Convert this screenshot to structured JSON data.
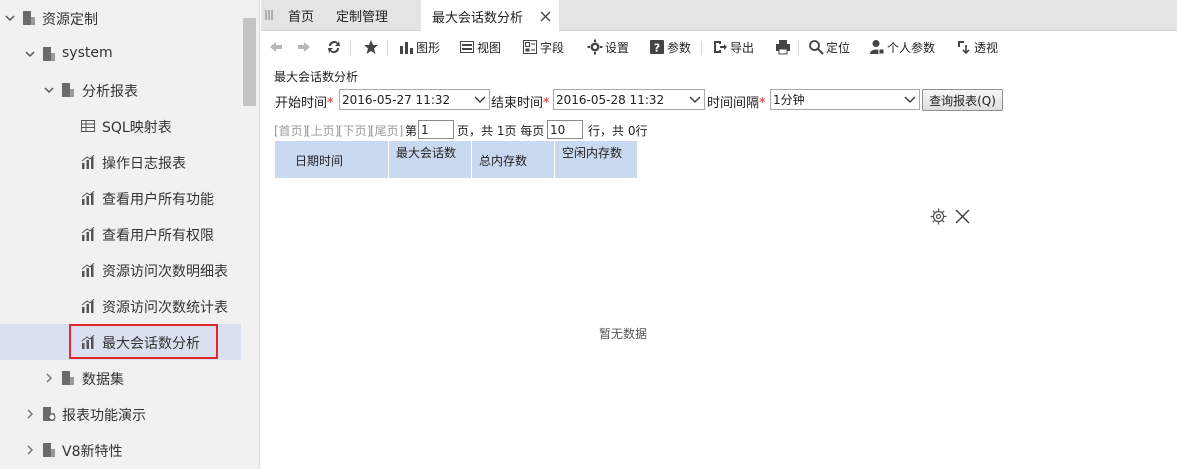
{
  "sidebar": {
    "items": [
      {
        "label": "资源定制",
        "expanded": true,
        "icon": "folder-icon"
      },
      {
        "label": "system",
        "expanded": true,
        "icon": "folder-icon"
      },
      {
        "label": "分析报表",
        "expanded": true,
        "icon": "folder-icon"
      },
      {
        "label": "SQL映射表",
        "icon": "sql-table-icon"
      },
      {
        "label": "操作日志报表",
        "icon": "report-icon"
      },
      {
        "label": "查看用户所有功能",
        "icon": "report-icon"
      },
      {
        "label": "查看用户所有权限",
        "icon": "report-icon"
      },
      {
        "label": "资源访问次数明细表",
        "icon": "report-icon"
      },
      {
        "label": "资源访问次数统计表",
        "icon": "report-icon"
      },
      {
        "label": "最大会话数分析",
        "icon": "report-icon",
        "selected": true
      },
      {
        "label": "数据集",
        "expanded": false,
        "icon": "folder-icon"
      },
      {
        "label": "报表功能演示",
        "expanded": false,
        "icon": "folder-icon"
      },
      {
        "label": "V8新特性",
        "expanded": false,
        "icon": "folder-icon"
      }
    ]
  },
  "tabs": [
    {
      "label": "首页"
    },
    {
      "label": "定制管理"
    },
    {
      "label": "最大会话数分析",
      "active": true
    }
  ],
  "toolbar": {
    "back_icon": "back-arrow-icon",
    "forward_icon": "forward-arrow-icon",
    "refresh_icon": "refresh-icon",
    "favorite_icon": "star-icon",
    "chart_label": "图形",
    "view_label": "视图",
    "field_label": "字段",
    "settings_label": "设置",
    "params_label": "参数",
    "export_label": "导出",
    "print_icon": "printer-icon",
    "locate_label": "定位",
    "personal_params_label": "个人参数",
    "pivot_label": "透视"
  },
  "report": {
    "title": "最大会话数分析",
    "start_label": "开始时间",
    "start_value": "2016-05-27 11:32",
    "end_label": "结束时间",
    "end_value": "2016-05-28 11:32",
    "interval_label": "时间间隔",
    "interval_value": "1分钟",
    "required_mark": "*",
    "query_button": "查询报表(Q)"
  },
  "pagination": {
    "first": "[首页]",
    "prev": "[上页]",
    "next": "[下页]",
    "last": "[尾页]",
    "page_prefix": "第",
    "page_value": "1",
    "page_suffix": "页，共 1页 每页",
    "per_page_value": "10",
    "rows_suffix": "行，共 0行"
  },
  "table": {
    "columns": [
      "日期时间",
      "最大会话数",
      "总内存数",
      "空闲内存数"
    ]
  },
  "empty_message": "暂无数据",
  "colors": {
    "selected_row": "#d9e0ef",
    "header_bg": "#c9daf0",
    "highlight_border": "#e5262b",
    "required": "#dd2222"
  }
}
